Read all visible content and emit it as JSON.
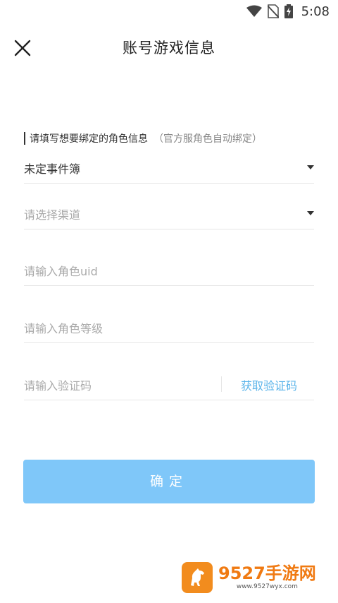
{
  "status_bar": {
    "time": "5:08",
    "icons": [
      "wifi-icon",
      "no-sim-icon",
      "battery-charging-icon"
    ]
  },
  "header": {
    "title": "账号游戏信息",
    "close_icon": "close-icon"
  },
  "form": {
    "hint_main": "请填写想要绑定的角色信息",
    "hint_sub": "（官方服角色自动绑定）",
    "game_select": {
      "value": "未定事件簿"
    },
    "channel_select": {
      "placeholder": "请选择渠道"
    },
    "uid_input": {
      "placeholder": "请输入角色uid"
    },
    "level_input": {
      "placeholder": "请输入角色等级"
    },
    "code_input": {
      "placeholder": "请输入验证码",
      "get_code_label": "获取验证码"
    },
    "confirm_label": "确定"
  },
  "watermark": {
    "brand": "9527手游网",
    "url": "www.9527wyx.com"
  },
  "colors": {
    "accent": "#5bb4ea",
    "button_bg": "#7fc7f9",
    "brand_orange": "#f07a12"
  }
}
